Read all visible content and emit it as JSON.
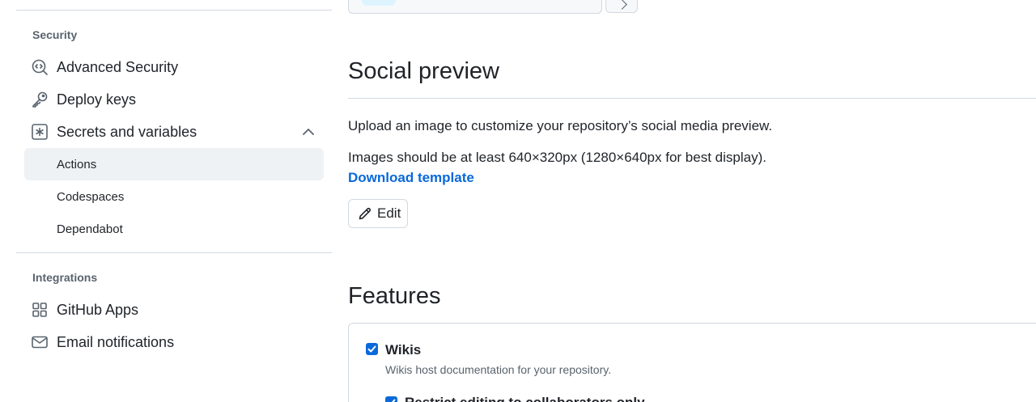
{
  "sidebar": {
    "security_heading": "Security",
    "security_items": [
      {
        "label": "Advanced Security",
        "icon": "codescan-icon"
      },
      {
        "label": "Deploy keys",
        "icon": "key-icon"
      },
      {
        "label": "Secrets and variables",
        "icon": "asterisk-icon",
        "expanded": true
      }
    ],
    "secrets_subitems": [
      {
        "label": "Actions",
        "active": true
      },
      {
        "label": "Codespaces",
        "active": false
      },
      {
        "label": "Dependabot",
        "active": false
      }
    ],
    "integrations_heading": "Integrations",
    "integrations_items": [
      {
        "label": "GitHub Apps",
        "icon": "apps-icon"
      },
      {
        "label": "Email notifications",
        "icon": "mail-icon"
      }
    ]
  },
  "main": {
    "social_preview": {
      "title": "Social preview",
      "description": "Upload an image to customize your repository’s social media preview.",
      "size_hint": "Images should be at least 640×320px (1280×640px for best display).",
      "download_link": "Download template",
      "edit_button": "Edit"
    },
    "features": {
      "title": "Features",
      "items": [
        {
          "label": "Wikis",
          "description": "Wikis host documentation for your repository.",
          "checked": true
        },
        {
          "label": "Restrict editing to collaborators only",
          "checked": true
        }
      ]
    }
  },
  "colors": {
    "accent": "#0969da",
    "text": "#1f2328",
    "muted": "#59636e",
    "border": "#d1d9e0",
    "active_bg": "#eff2f5"
  }
}
